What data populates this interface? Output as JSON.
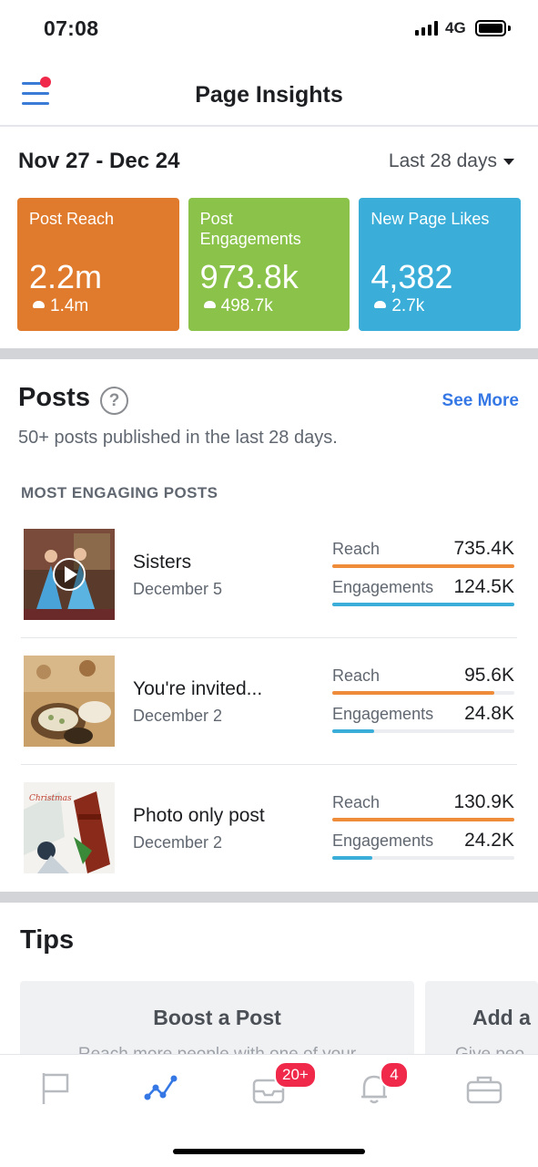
{
  "status_bar": {
    "time": "07:08",
    "network": "4G"
  },
  "header": {
    "title": "Page Insights",
    "menu_icon": "hamburger-menu-icon",
    "has_notification_dot": true
  },
  "date_range": "Nov 27 - Dec 24",
  "period_select": "Last 28 days",
  "stats": [
    {
      "label": "Post Reach",
      "value": "2.2m",
      "delta": "1.4m",
      "color": "#e07b2e"
    },
    {
      "label": "Post Engagements",
      "value": "973.8k",
      "delta": "498.7k",
      "color": "#8bc34a"
    },
    {
      "label": "New Page Likes",
      "value": "4,382",
      "delta": "2.7k",
      "color": "#3aaed8"
    }
  ],
  "posts": {
    "title": "Posts",
    "see_more": "See More",
    "subtitle": "50+ posts published in the last 28 days.",
    "section_label": "MOST ENGAGING POSTS",
    "items": [
      {
        "name": "Sisters",
        "date": "December 5",
        "reach_label": "Reach",
        "reach": "735.4K",
        "reach_fraction": 1.0,
        "engagements_label": "Engagements",
        "engagements": "124.5K",
        "engagements_fraction": 1.0,
        "has_video": true
      },
      {
        "name": "You're invited...",
        "date": "December 2",
        "reach_label": "Reach",
        "reach": "95.6K",
        "reach_fraction": 0.89,
        "engagements_label": "Engagements",
        "engagements": "24.8K",
        "engagements_fraction": 0.23,
        "has_video": false
      },
      {
        "name": "Photo only post",
        "date": "December 2",
        "reach_label": "Reach",
        "reach": "130.9K",
        "reach_fraction": 1.0,
        "engagements_label": "Engagements",
        "engagements": "24.2K",
        "engagements_fraction": 0.22,
        "has_video": false
      }
    ]
  },
  "tips": {
    "title": "Tips",
    "cards": [
      {
        "title": "Boost a Post",
        "text": "Reach more people with one of your"
      },
      {
        "title": "Add a",
        "text": "Give peo"
      }
    ]
  },
  "tab_bar": {
    "tabs": [
      {
        "icon": "flag-icon"
      },
      {
        "icon": "insights-icon",
        "active": true
      },
      {
        "icon": "inbox-icon",
        "badge": "20+"
      },
      {
        "icon": "bell-icon",
        "badge": "4"
      },
      {
        "icon": "briefcase-icon"
      }
    ]
  },
  "colors": {
    "accent": "#3578e5",
    "reach_bar": "#ee8c3a",
    "engagement_bar": "#3aaed8",
    "badge": "#f02849"
  }
}
